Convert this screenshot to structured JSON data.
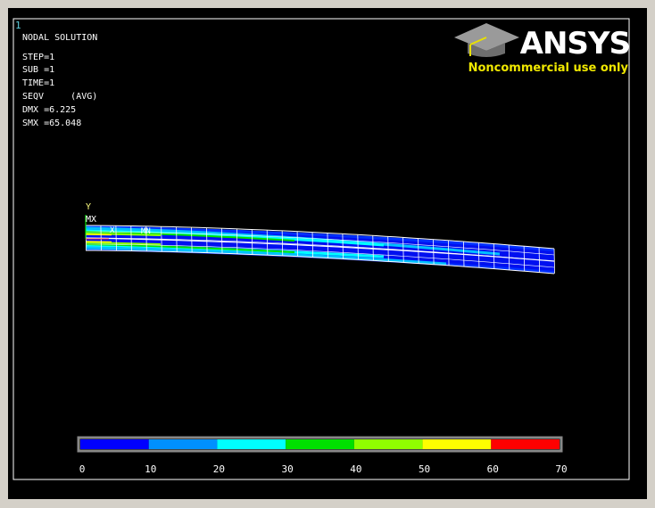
{
  "window": {
    "number": "1"
  },
  "info": {
    "title": "NODAL SOLUTION",
    "step": "STEP=1",
    "sub": "SUB =1",
    "time": "TIME=1",
    "seqv": "SEQV     (AVG)",
    "dmx": "DMX =6.225",
    "smx": "SMX =65.048"
  },
  "logo": {
    "wordmark": "ANSYS",
    "tagline": "Noncommercial use only",
    "icon": "graduation-cap-icon"
  },
  "triad": {
    "y_label": "Y",
    "x_label": "X"
  },
  "markers": {
    "mx": "MX",
    "mn": "MN"
  },
  "legend": {
    "ticks": [
      "0",
      "10",
      "20",
      "30",
      "40",
      "50",
      "60",
      "70"
    ],
    "colors": [
      "#0000ff",
      "#0090ff",
      "#00ffff",
      "#00e000",
      "#90ff00",
      "#ffff00",
      "#ff0000"
    ]
  },
  "colors": {
    "background": "#000000",
    "frame": "#d4d0c8",
    "mesh": "#ffffff",
    "tagline": "#f0e800"
  }
}
